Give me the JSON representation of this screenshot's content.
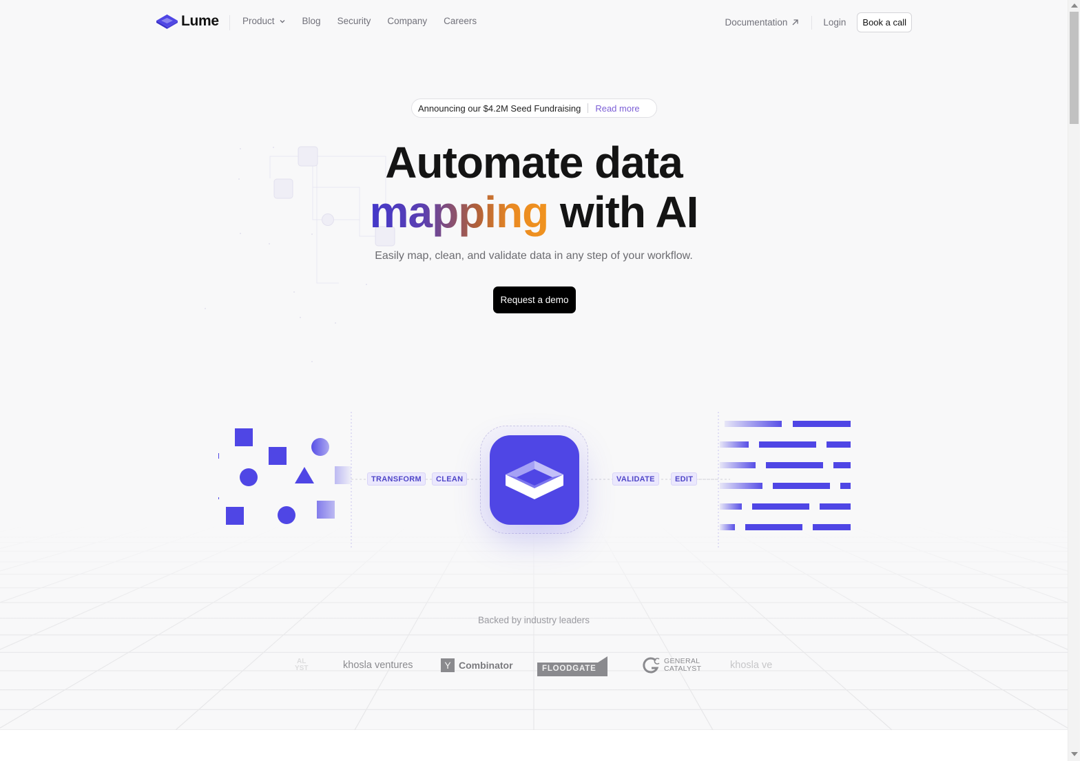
{
  "brand": {
    "name": "Lume",
    "color": "#4f46e5"
  },
  "nav": {
    "links": [
      {
        "label": "Product",
        "has_dropdown": true
      },
      {
        "label": "Blog"
      },
      {
        "label": "Security"
      },
      {
        "label": "Company"
      },
      {
        "label": "Careers"
      }
    ],
    "documentation": "Documentation",
    "login": "Login",
    "book_call": "Book a call"
  },
  "announcement": {
    "text": "Announcing our $4.2M Seed Fundraising",
    "link": "Read more"
  },
  "hero": {
    "line1": "Automate data",
    "line2_highlight": "mapping",
    "line2_rest": " with AI",
    "subtitle": "Easily map, clean, and validate data in any step of your workflow.",
    "cta": "Request a demo"
  },
  "flow": {
    "steps_left": [
      "TRANSFORM",
      "CLEAN"
    ],
    "steps_right": [
      "VALIDATE",
      "EDIT"
    ],
    "accent": "#4f46e5",
    "pill_bg": "#ebe8fd"
  },
  "backers": {
    "label": "Backed by industry leaders",
    "logos": [
      {
        "name": "general-catalyst-partial",
        "text": "AL\nYST"
      },
      {
        "name": "khosla-ventures",
        "text": "khosla ventures"
      },
      {
        "name": "y-combinator",
        "badge": "Y",
        "text": "Combinator"
      },
      {
        "name": "floodgate",
        "text": "FLOODGATE"
      },
      {
        "name": "general-catalyst",
        "line1": "GENERAL",
        "line2": "CATALYST"
      },
      {
        "name": "khosla-ventures-partial",
        "text": "khosla ve"
      }
    ]
  }
}
